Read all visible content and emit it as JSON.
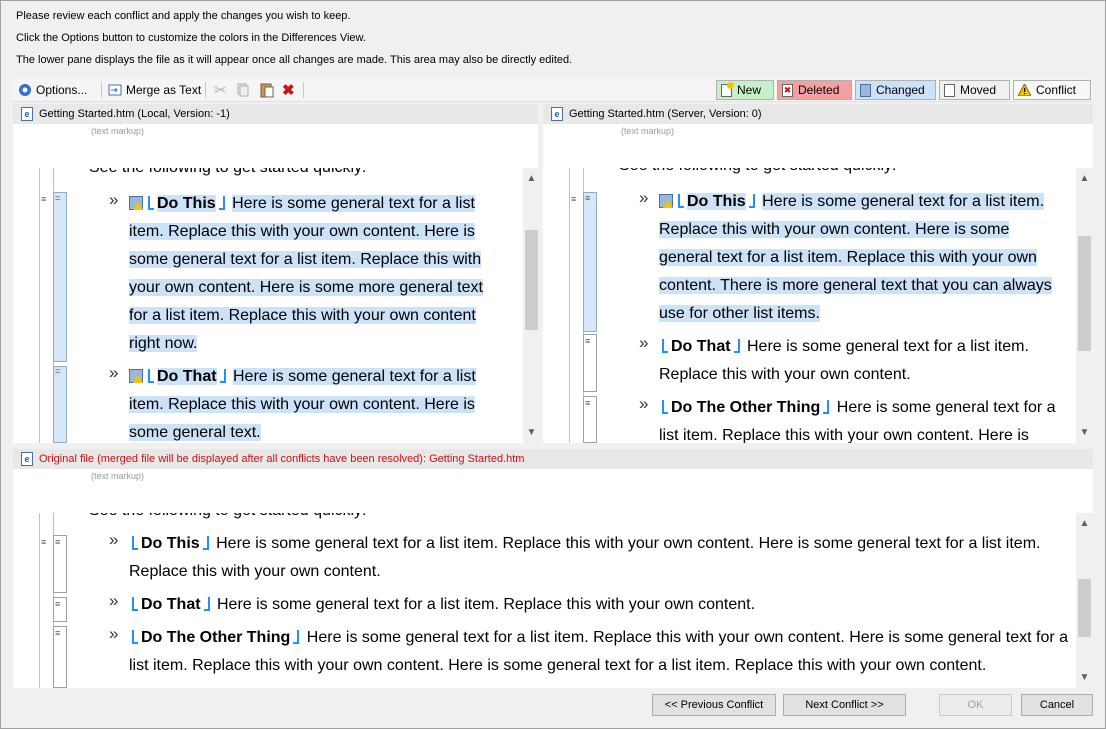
{
  "instructions": {
    "line1": "Please review each conflict and apply the changes you wish to keep.",
    "line2": "Click the Options button to customize the colors in the Differences View.",
    "line3": "The lower pane displays the file as it will appear once all changes are made. This area may also be directly edited."
  },
  "toolbar": {
    "options_label": "Options...",
    "merge_label": "Merge as Text"
  },
  "legend": {
    "new": "New",
    "deleted": "Deleted",
    "changed": "Changed",
    "moved": "Moved",
    "conflict": "Conflict",
    "colors": {
      "new": "#c8f0c8",
      "deleted": "#f4a0a0",
      "changed": "#cce2f8",
      "moved": "#f0f0f0",
      "conflict": "#f8f8f8"
    }
  },
  "left_pane": {
    "header": "Getting Started.htm (Local, Version: -1)",
    "markup_label": "(text markup)",
    "cut_line": "See the following to get started quickly:",
    "item1_title": "Do This",
    "item1_l1": "Here is some general text for a list",
    "item1_l2": "item. Replace this with your own content. Here is",
    "item1_l3": "some general text for a list item. Replace this with",
    "item1_l4": "your own content. Here is some more general text",
    "item1_l5": "for a list item. Replace this with your own content",
    "item1_l6": "right now.",
    "item2_title": "Do That",
    "item2_l1": "Here is some general text for a list",
    "item2_l2": "item. Replace this with your own content. Here is",
    "item2_l3": "some general text."
  },
  "right_pane": {
    "header": "Getting Started.htm (Server, Version: 0)",
    "markup_label": "(text markup)",
    "cut_line": "See the following to get started quickly:",
    "item1_title": "Do This",
    "item1_l1": "Here is some general text for a list item.",
    "item1_l2": "Replace this with your own content. Here is some",
    "item1_l3": "general text for a list item. Replace this with your own",
    "item1_l4": "content. There is more general text that you can always",
    "item1_l5": "use for other list items.",
    "item2_title": "Do That",
    "item2_l1": "Here is some general text for a list item.",
    "item2_l2": "Replace this with your own content.",
    "item3_title": "Do The Other Thing",
    "item3_l1": "Here is some general text for a",
    "item3_l2": "list item. Replace this with your own content. Here is"
  },
  "bottom_pane": {
    "header": "Original file (merged file will be displayed after all conflicts have been resolved): Getting Started.htm",
    "markup_label": "(text markup)",
    "cut_line": "See the following to get started quickly:",
    "item1_title": "Do This",
    "item1_l1": "Here is some general text for a list item. Replace this with your own content. Here is some general text for a list item.",
    "item1_l2": "Replace this with your own content.",
    "item2_title": "Do That",
    "item2_l1": "Here is some general text for a list item. Replace this with your own content.",
    "item3_title": "Do The Other Thing",
    "item3_l1": "Here is some general text for a list item. Replace this with your own content. Here is some general text for a",
    "item3_l2": "list item. Replace this with your own content. Here is some general text for a list item. Replace this with your own content."
  },
  "buttons": {
    "prev": "<< Previous Conflict",
    "next": "Next Conflict >>",
    "ok": "OK",
    "cancel": "Cancel"
  },
  "bullet_glyph": "»"
}
